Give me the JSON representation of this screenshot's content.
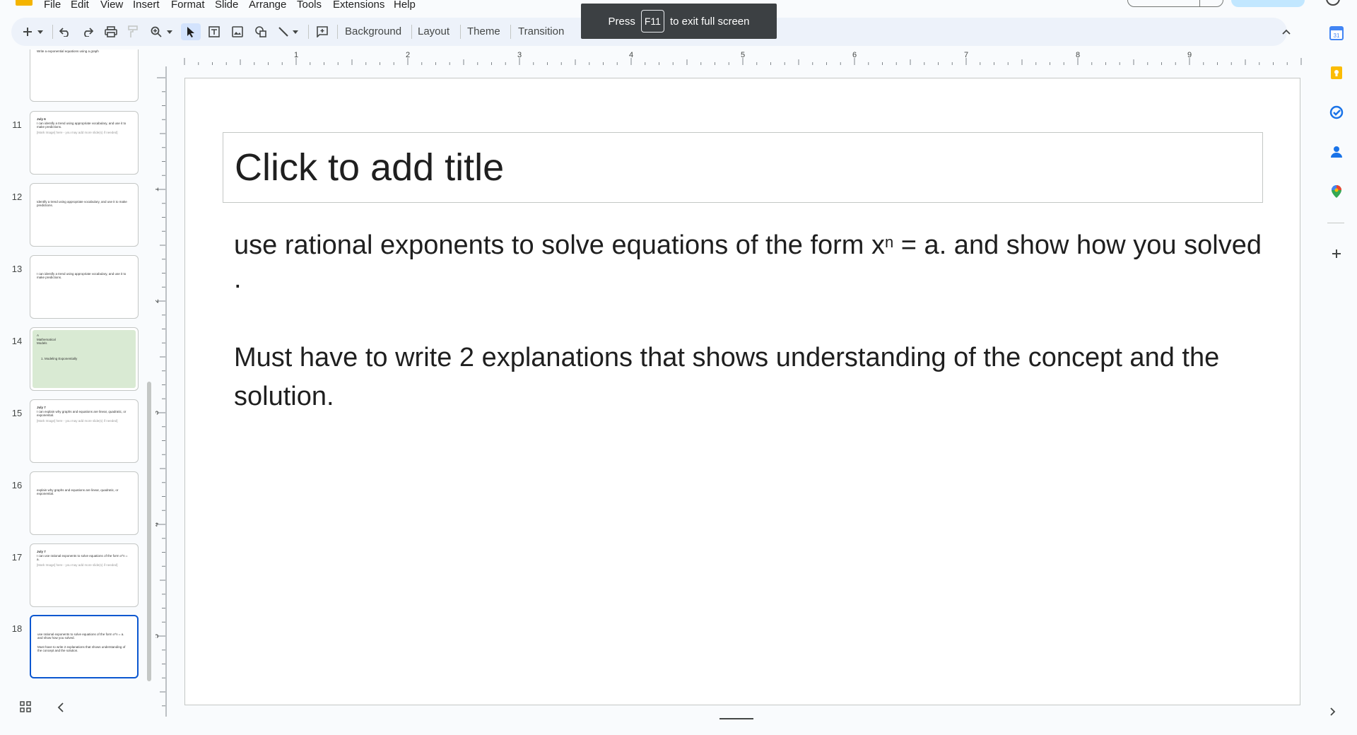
{
  "menu": [
    "File",
    "Edit",
    "View",
    "Insert",
    "Format",
    "Slide",
    "Arrange",
    "Tools",
    "Extensions",
    "Help"
  ],
  "toolbar": {
    "buttons": [
      "Background",
      "Layout",
      "Theme",
      "Transition"
    ],
    "icons": [
      "new-slide-icon",
      "dropdown-arrow-icon",
      "undo-icon",
      "redo-icon",
      "print-icon",
      "paint-format-icon",
      "zoom-icon",
      "select-icon",
      "text-box-icon",
      "image-icon",
      "shape-icon",
      "line-icon",
      "comment-icon",
      "collapse-toolbar-icon"
    ]
  },
  "fullscreen_toast": {
    "press": "Press",
    "key": "F11",
    "suffix": "to exit full screen"
  },
  "filmstrip": {
    "slides": [
      {
        "num": "",
        "lines": [
          "Write a exponential equations using a graph"
        ]
      },
      {
        "num": "11",
        "lines": [
          "July 6",
          "I can identify a trend using appropriate vocabulary, and use it to make predictions.",
          "[Mark Image] here - you may add more slide(s) if needed]"
        ]
      },
      {
        "num": "12",
        "lines": [
          "Identify a trend using appropriate vocabulary, and use it to make predictions."
        ]
      },
      {
        "num": "13",
        "lines": [
          "I can identify a trend using appropriate vocabulary, and use it to make predictions."
        ]
      },
      {
        "num": "14",
        "lines": [
          "A",
          "Mathematical",
          "Models",
          "1. Modeling Exponentially"
        ]
      },
      {
        "num": "15",
        "lines": [
          "July 7",
          "I can explain why graphs and equations are linear, quadratic, or exponential.",
          "[Mark Image] here - you may add more slide(s) if needed]"
        ]
      },
      {
        "num": "16",
        "lines": [
          "explain why graphs and equations are linear, quadratic, or exponential."
        ]
      },
      {
        "num": "17",
        "lines": [
          "July 7",
          "I can use rational exponents to solve equations of the form x^n = a.",
          "[Mark Image] here - you may add more slide(s) if needed]"
        ]
      },
      {
        "num": "18",
        "lines": [
          "use rational exponents to solve equations of the form x^n = a. and show how you solved.",
          "Must have to write 2 explanations that shows understanding of the concept and the solution."
        ]
      }
    ]
  },
  "ruler": {
    "h_labels": [
      "1",
      "2",
      "3",
      "4",
      "5",
      "6",
      "7",
      "8",
      "9"
    ],
    "v_labels": [
      "1",
      "2",
      "3",
      "4",
      "5"
    ]
  },
  "slide": {
    "title_placeholder": "Click to add title",
    "body_line1_pre": "use rational exponents to solve equations of the form x",
    "body_sup": "n",
    "body_line1_post": " = a. and show how you solved .",
    "body_para2": "Must have to write 2 explanations that shows understanding of the concept and the solution."
  },
  "side_panel": {
    "icons": [
      "calendar-icon",
      "keep-icon",
      "tasks-icon",
      "contacts-icon",
      "maps-icon",
      "add-icon",
      "expand-icon"
    ],
    "calendar_day": "31"
  },
  "colors": {
    "accent": "#0b57d0",
    "toolbar_bg": "#edf2fa",
    "selected_tool": "#d3e3fd",
    "green_slide": "#d9ead3"
  }
}
